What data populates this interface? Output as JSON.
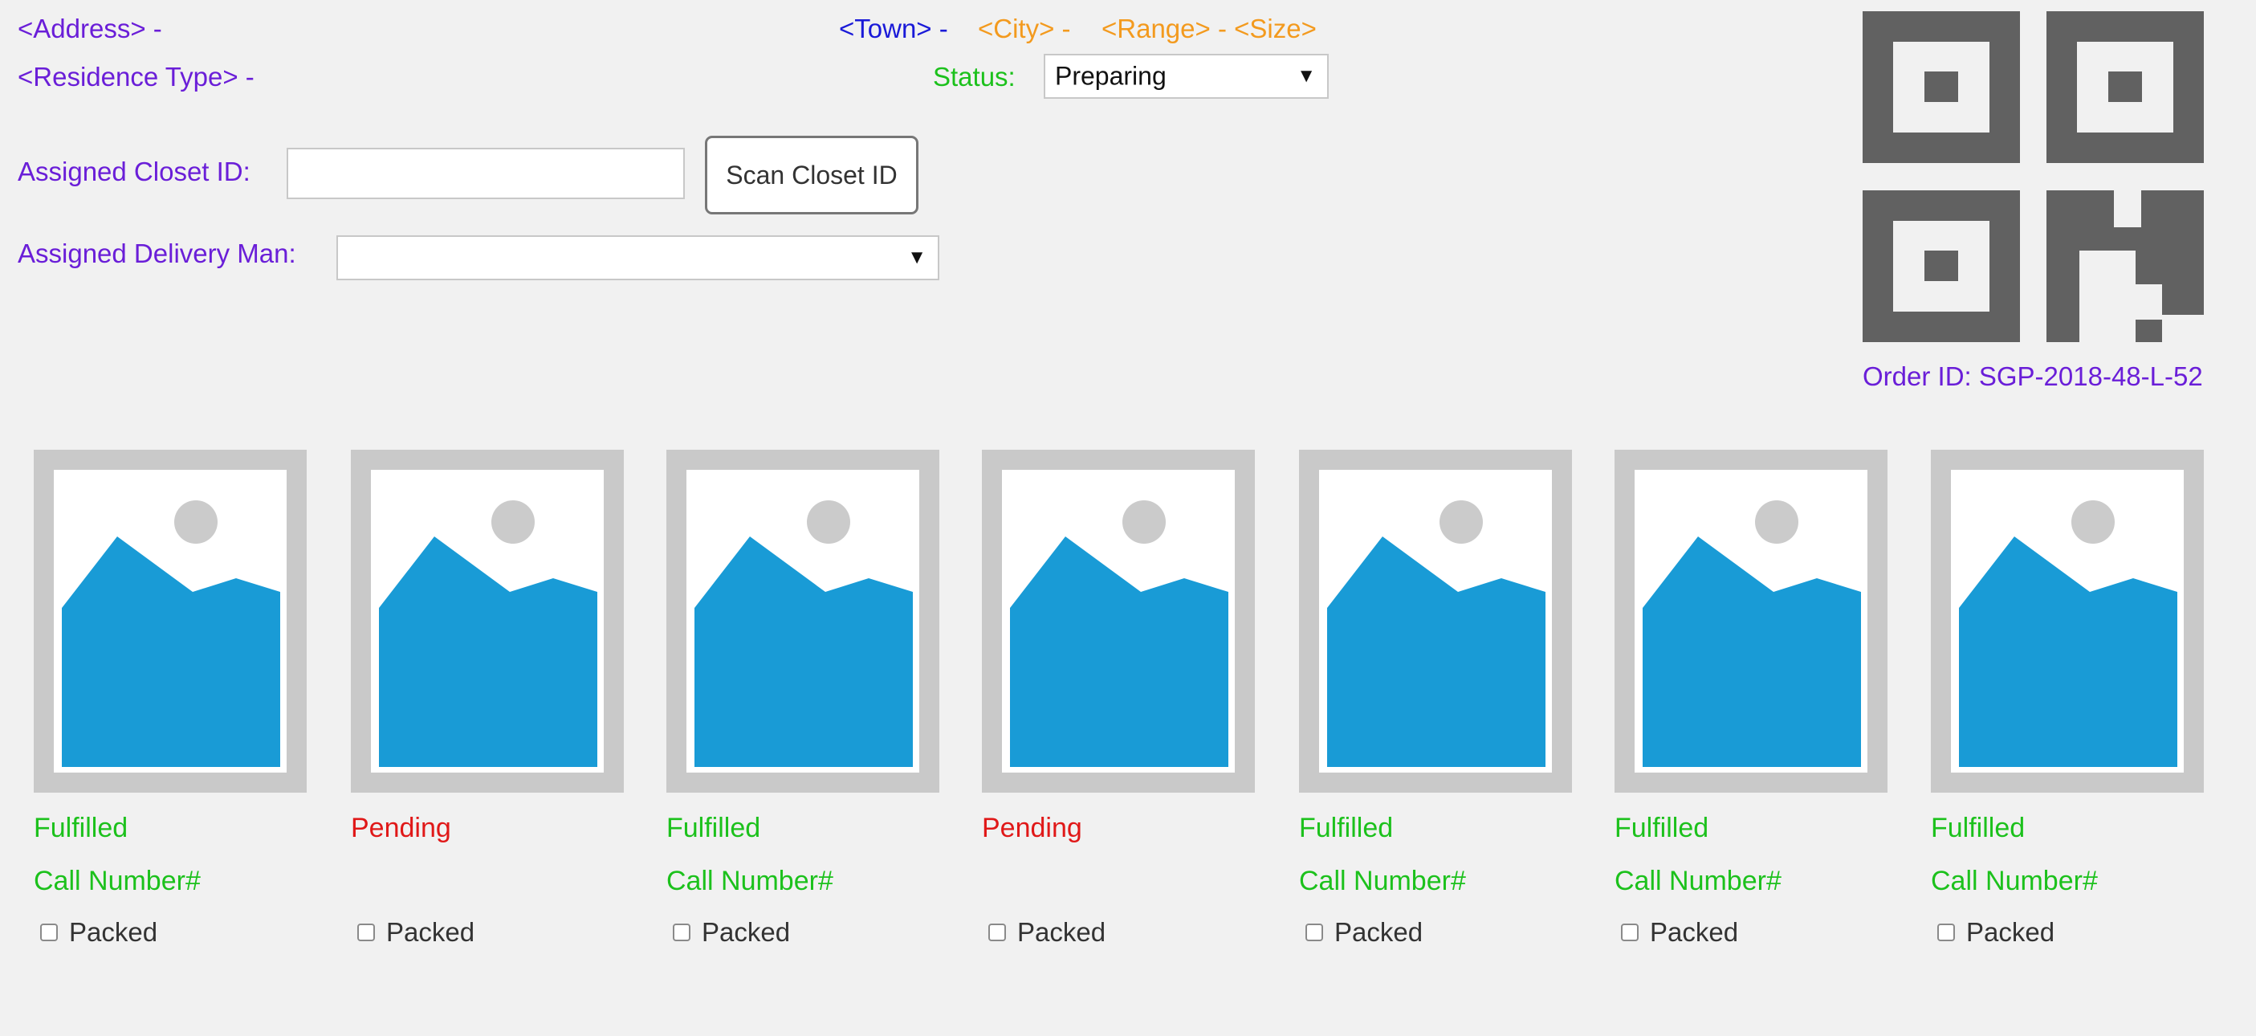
{
  "header": {
    "address": "<Address> -",
    "residence_type": "<Residence Type> -",
    "town": "<Town> -",
    "city": "<City> -",
    "range_size": "<Range> - <Size>",
    "status_label": "Status:",
    "status_value": "Preparing"
  },
  "closet": {
    "label": "Assigned Closet ID:",
    "value": "",
    "scan_button": "Scan Closet ID"
  },
  "delivery": {
    "label": "Assigned Delivery Man:",
    "value": ""
  },
  "order": {
    "id_text": "Order ID: SGP-2018-48-L-52"
  },
  "colors": {
    "label_purple": "#6a1ed8",
    "town_blue": "#1a1ad8",
    "orange": "#f39a1e",
    "fulfilled_green": "#1cc11c",
    "pending_red": "#e01818",
    "qr_gray": "#616161",
    "image_blue": "#199bd6"
  },
  "items": [
    {
      "status": "Fulfilled",
      "call_number": "Call Number#",
      "packed_label": "Packed",
      "packed": false
    },
    {
      "status": "Pending",
      "call_number": "",
      "packed_label": "Packed",
      "packed": false
    },
    {
      "status": "Fulfilled",
      "call_number": "Call Number#",
      "packed_label": "Packed",
      "packed": false
    },
    {
      "status": "Pending",
      "call_number": "",
      "packed_label": "Packed",
      "packed": false
    },
    {
      "status": "Fulfilled",
      "call_number": "Call Number#",
      "packed_label": "Packed",
      "packed": false
    },
    {
      "status": "Fulfilled",
      "call_number": "Call Number#",
      "packed_label": "Packed",
      "packed": false
    },
    {
      "status": "Fulfilled",
      "call_number": "Call Number#",
      "packed_label": "Packed",
      "packed": false
    }
  ]
}
